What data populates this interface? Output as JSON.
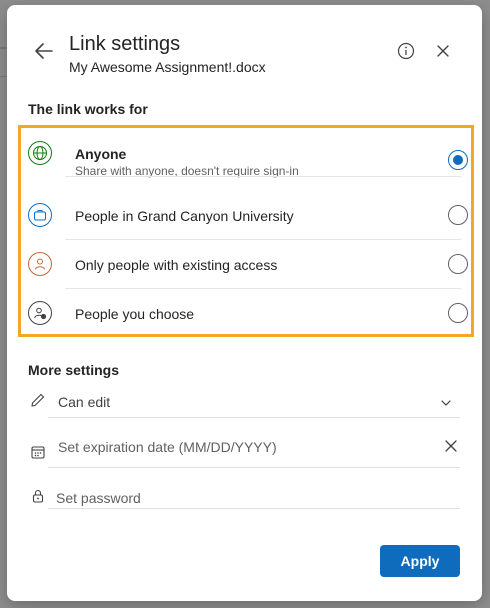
{
  "dialog": {
    "title": "Link settings",
    "file_name": "My Awesome Assignment!.docx",
    "icons": {
      "back": "back-arrow-icon",
      "info": "info-icon",
      "close": "close-icon"
    }
  },
  "link_works_for": {
    "label": "The link works for",
    "options": [
      {
        "label": "Anyone",
        "description": "Share with anyone, doesn't require sign-in",
        "icon": "globe-icon",
        "selected": true
      },
      {
        "label": "People in Grand Canyon University",
        "icon": "briefcase-icon",
        "selected": false
      },
      {
        "label": "Only people with existing access",
        "icon": "person-icon",
        "selected": false
      },
      {
        "label": "People you choose",
        "icon": "person-add-icon",
        "selected": false
      }
    ]
  },
  "more_settings": {
    "label": "More settings",
    "permission": {
      "value": "Can edit",
      "icon": "pencil-icon"
    },
    "expiration": {
      "placeholder": "Set expiration date (MM/DD/YYYY)",
      "icon": "calendar-icon",
      "clear_icon": "close-icon"
    },
    "password": {
      "placeholder": "Set password",
      "icon": "lock-icon"
    }
  },
  "footer": {
    "apply_label": "Apply"
  },
  "colors": {
    "accent": "#0f6cbd",
    "highlight_border": "#f5a623"
  }
}
